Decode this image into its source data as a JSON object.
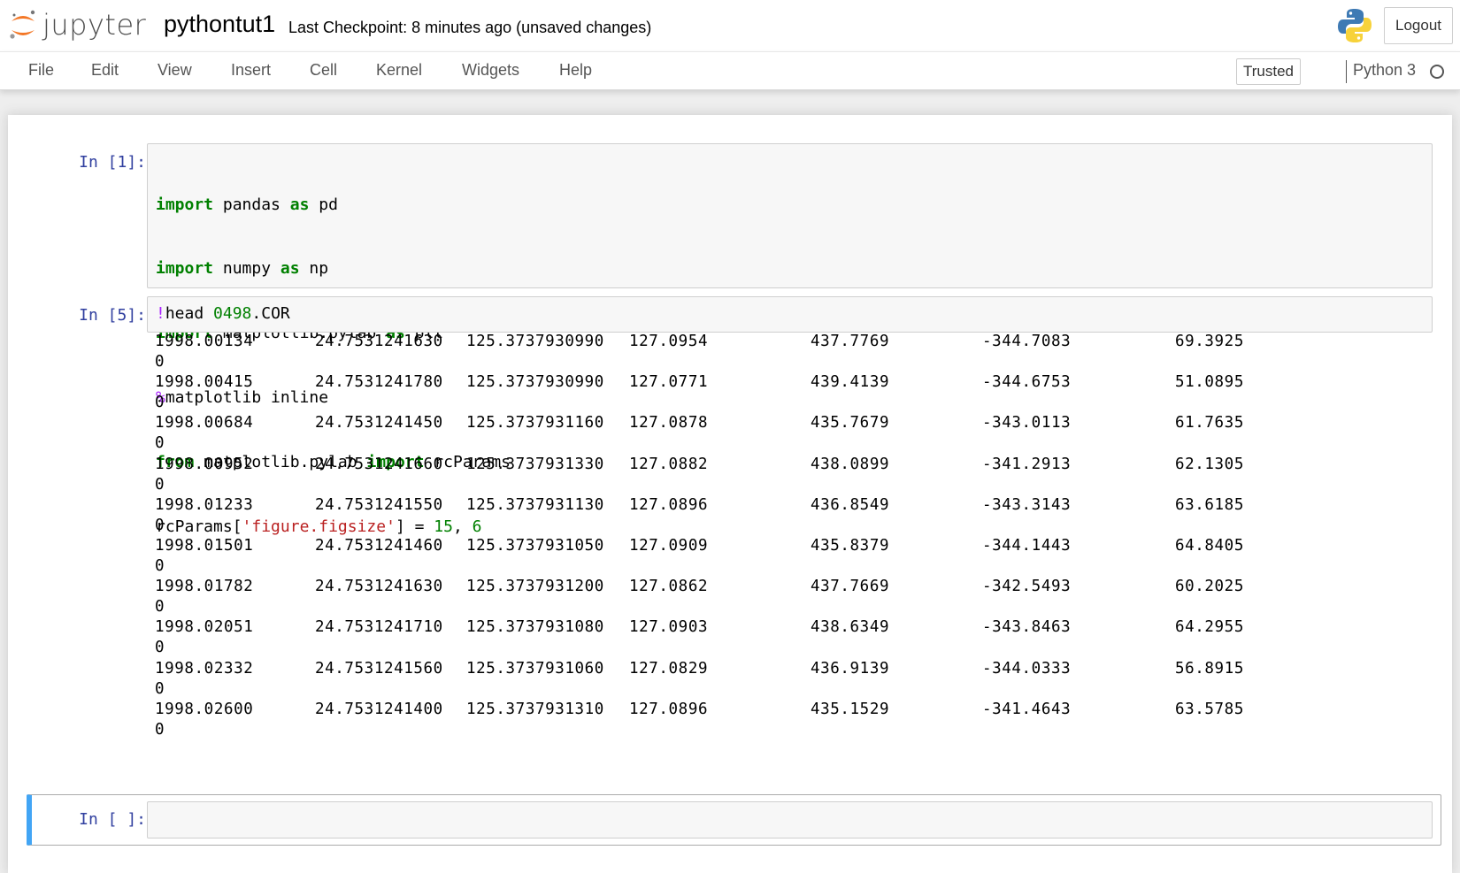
{
  "header": {
    "logo_text": "jupyter",
    "notebook_name": "pythontut1",
    "checkpoint_text": "Last Checkpoint: 8 minutes ago (unsaved changes)",
    "logout_label": "Logout"
  },
  "menubar": {
    "items": [
      "File",
      "Edit",
      "View",
      "Insert",
      "Cell",
      "Kernel",
      "Widgets",
      "Help"
    ],
    "trusted_label": "Trusted",
    "kernel_name": "Python 3"
  },
  "cells": {
    "cell1": {
      "prompt": "In [1]:"
    },
    "cell2": {
      "prompt": "In [5]:"
    },
    "cell3": {
      "prompt": "In [ ]:"
    }
  },
  "code1": {
    "l1": {
      "k1": "import",
      "t1": " pandas ",
      "k2": "as",
      "t2": " pd"
    },
    "l2": {
      "k1": "import",
      "t1": " numpy ",
      "k2": "as",
      "t2": " np"
    },
    "l3": {
      "k1": "import",
      "t1": " matplotlib.pylab ",
      "k2": "as",
      "t2": " plt"
    },
    "l4": {
      "m": "%",
      "t": "matplotlib inline"
    },
    "l5": {
      "k1": "from",
      "t1": " matplotlib.pylab ",
      "k2": "import",
      "t2": " rcParams"
    },
    "l6": {
      "t1": "rcParams[",
      "s": "'figure.figsize'",
      "t2": "] = ",
      "n1": "15",
      "t3": ", ",
      "n2": "6"
    }
  },
  "code2": {
    "bang": "!",
    "cmd": "head ",
    "num": "0498",
    "ext": ".COR"
  },
  "output_rows": [
    [
      "1998.00134",
      "24.7531241630",
      "125.3737930990",
      "127.0954",
      "437.7769",
      "-344.7083",
      "69.3925",
      "0"
    ],
    [
      "1998.00415",
      "24.7531241780",
      "125.3737930990",
      "127.0771",
      "439.4139",
      "-344.6753",
      "51.0895",
      "0"
    ],
    [
      "1998.00684",
      "24.7531241450",
      "125.3737931160",
      "127.0878",
      "435.7679",
      "-343.0113",
      "61.7635",
      "0"
    ],
    [
      "1998.00952",
      "24.7531241660",
      "125.3737931330",
      "127.0882",
      "438.0899",
      "-341.2913",
      "62.1305",
      "0"
    ],
    [
      "1998.01233",
      "24.7531241550",
      "125.3737931130",
      "127.0896",
      "436.8549",
      "-343.3143",
      "63.6185",
      "0"
    ],
    [
      "1998.01501",
      "24.7531241460",
      "125.3737931050",
      "127.0909",
      "435.8379",
      "-344.1443",
      "64.8405",
      "0"
    ],
    [
      "1998.01782",
      "24.7531241630",
      "125.3737931200",
      "127.0862",
      "437.7669",
      "-342.5493",
      "60.2025",
      "0"
    ],
    [
      "1998.02051",
      "24.7531241710",
      "125.3737931080",
      "127.0903",
      "438.6349",
      "-343.8463",
      "64.2955",
      "0"
    ],
    [
      "1998.02332",
      "24.7531241560",
      "125.3737931060",
      "127.0829",
      "436.9139",
      "-344.0333",
      "56.8915",
      "0"
    ],
    [
      "1998.02600",
      "24.7531241400",
      "125.3737931310",
      "127.0896",
      "435.1529",
      "-341.4643",
      "63.5785",
      "0"
    ]
  ]
}
